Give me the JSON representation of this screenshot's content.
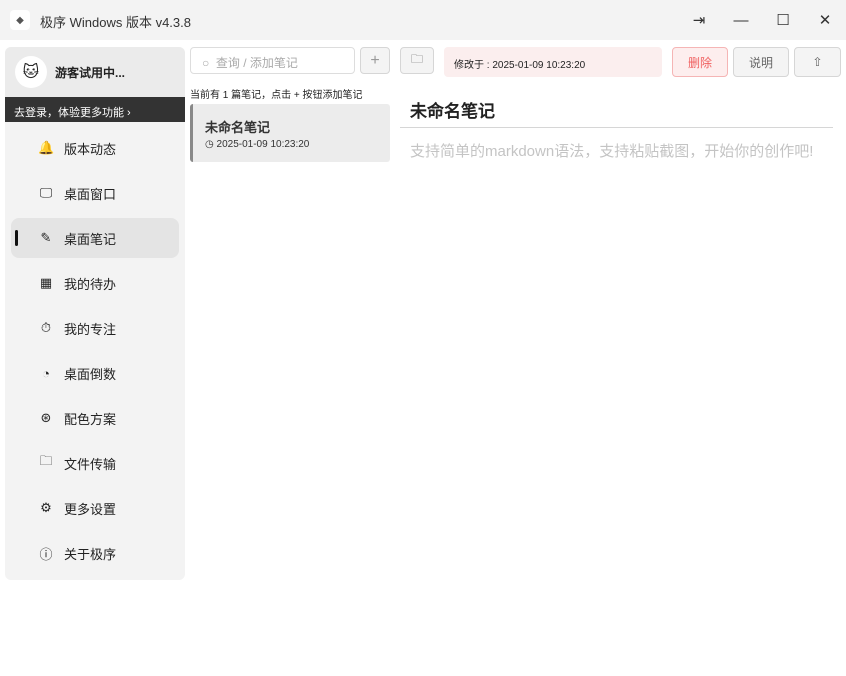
{
  "window": {
    "title": "极序 Windows 版本 v4.3.8"
  },
  "sidebar": {
    "guest": "游客试用中...",
    "login_banner": "去登录，体验更多功能 ›",
    "items": [
      {
        "label": "版本动态",
        "icon": "bell-icon",
        "glyph": "🔔"
      },
      {
        "label": "桌面窗口",
        "icon": "monitor-icon",
        "glyph": "🖵"
      },
      {
        "label": "桌面笔记",
        "icon": "edit-icon",
        "glyph": "✎"
      },
      {
        "label": "我的待办",
        "icon": "calendar-icon",
        "glyph": "▦"
      },
      {
        "label": "我的专注",
        "icon": "stopwatch-icon",
        "glyph": "⏱"
      },
      {
        "label": "桌面倒数",
        "icon": "gauge-icon",
        "glyph": "◔"
      },
      {
        "label": "配色方案",
        "icon": "palette-icon",
        "glyph": "⊛"
      },
      {
        "label": "文件传输",
        "icon": "folder-icon",
        "glyph": "🗀"
      },
      {
        "label": "更多设置",
        "icon": "gear-icon",
        "glyph": "⚙"
      },
      {
        "label": "关于极序",
        "icon": "info-icon",
        "glyph": "ⓘ"
      }
    ],
    "active_index": 2
  },
  "notes": {
    "search_placeholder": "查询 / 添加笔记",
    "info": "当前有 1 篇笔记，点击 + 按钮添加笔记",
    "list": [
      {
        "title": "未命名笔记",
        "time": "2025-01-09 10:23:20"
      }
    ]
  },
  "editor": {
    "modified": "修改于 : 2025-01-09 10:23:20",
    "delete": "删除",
    "help": "说明",
    "title": "未命名笔记",
    "placeholder": "支持简单的markdown语法，支持粘贴截图，开始你的创作吧!"
  }
}
